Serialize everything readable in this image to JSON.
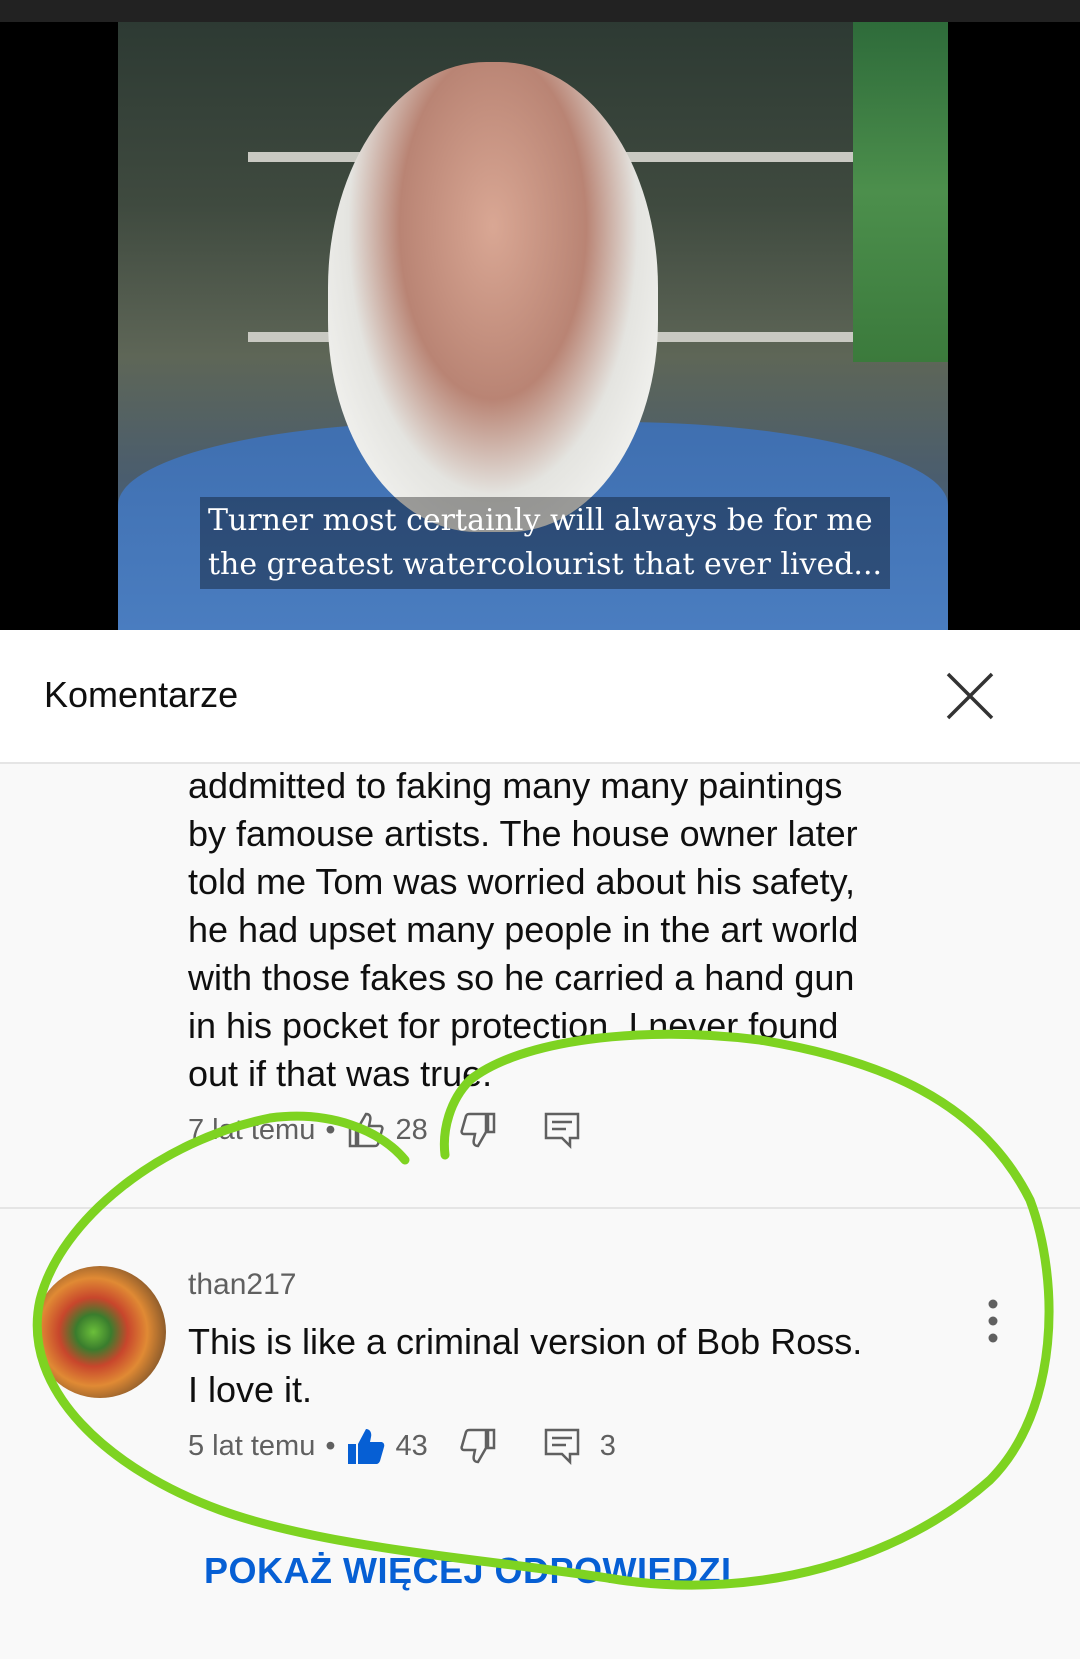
{
  "video": {
    "subtitle_line1": "Turner most certainly will always be for me",
    "subtitle_line2": "the greatest watercolourist that ever lived..."
  },
  "panel": {
    "title": "Komentarze",
    "close_icon": "close-icon"
  },
  "comments": [
    {
      "text_lines": [
        "addmitted to faking many many paintings",
        "by famouse artists. The house owner later",
        "told me Tom was worried about his safety,",
        "he had upset many people in the art world",
        "with those fakes so he carried a hand gun",
        "in his pocket for protection. I never found",
        "out if that was true."
      ],
      "time": "7 lat temu",
      "likes": "28",
      "replies": ""
    },
    {
      "author": "than217",
      "text_lines": [
        "This is like a criminal version of Bob Ross.",
        "I love it."
      ],
      "time": "5 lat temu",
      "likes": "43",
      "replies": "3",
      "liked": true
    }
  ],
  "show_more_label": "POKAŻ WIĘCEJ ODPOWIEDZI",
  "colors": {
    "accent_blue": "#065fd4",
    "annotation_green": "#7ed321"
  }
}
